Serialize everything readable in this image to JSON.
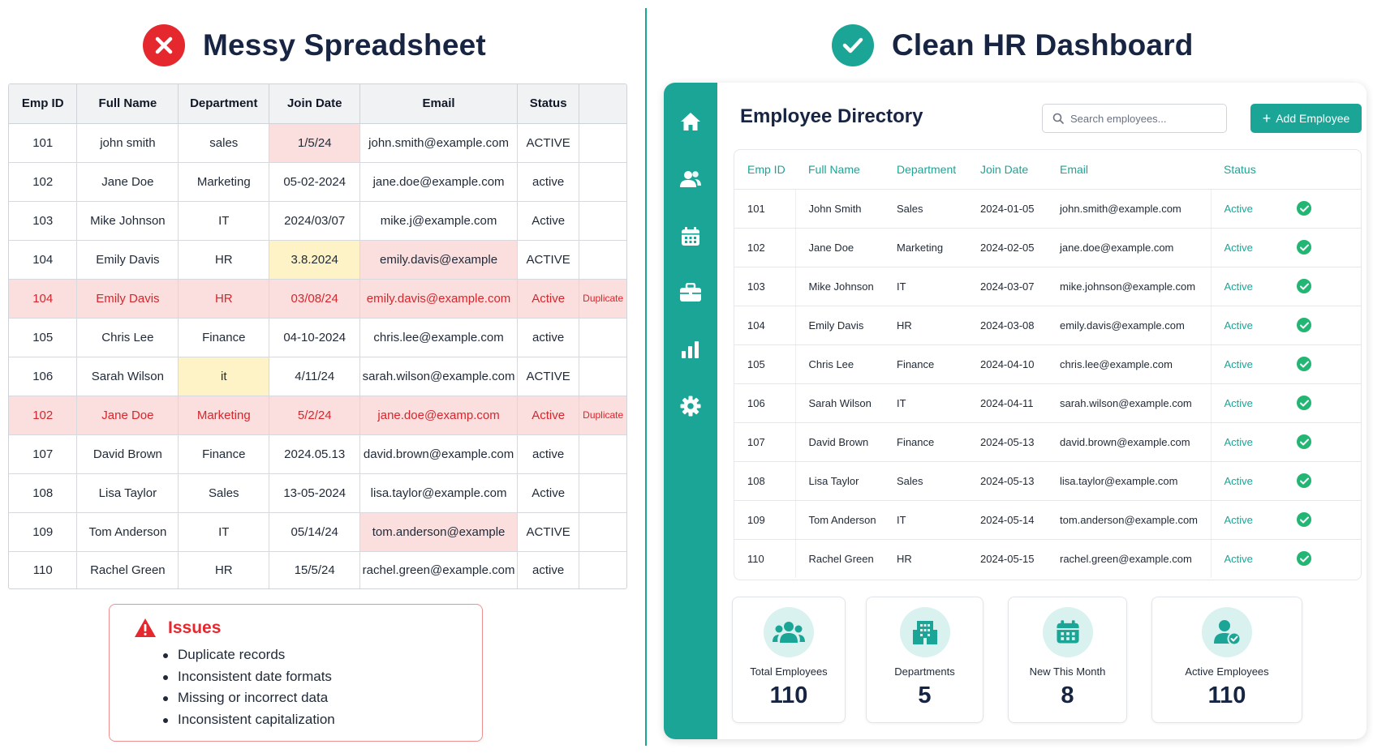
{
  "colors": {
    "teal": "#1aa597",
    "red": "#e5282e",
    "navy": "#172543",
    "highlight_red": "#fbdfdf",
    "highlight_yellow": "#fdf3c6"
  },
  "messy": {
    "title": "Messy Spreadsheet",
    "title_icon": "x-circle-icon",
    "columns": [
      "Emp ID",
      "Full Name",
      "Department",
      "Join Date",
      "Email",
      "Status",
      ""
    ],
    "rows": [
      {
        "id": "101",
        "name": "john smith",
        "dept": "sales",
        "date": "1/5/24",
        "email": "john.smith@example.com",
        "status": "ACTIVE",
        "tag": ""
      },
      {
        "id": "102",
        "name": "Jane Doe",
        "dept": "Marketing",
        "date": "05-02-2024",
        "email": "jane.doe@example.com",
        "status": "active",
        "tag": ""
      },
      {
        "id": "103",
        "name": "Mike Johnson",
        "dept": "IT",
        "date": "2024/03/07",
        "email": "mike.j@example.com",
        "status": "Active",
        "tag": ""
      },
      {
        "id": "104",
        "name": "Emily Davis",
        "dept": "HR",
        "date": "3.8.2024",
        "email": "emily.davis@example",
        "status": "ACTIVE",
        "tag": ""
      },
      {
        "id": "104",
        "name": "Emily Davis",
        "dept": "HR",
        "date": "03/08/24",
        "email": "emily.davis@example.com",
        "status": "Active",
        "tag": "Duplicate"
      },
      {
        "id": "105",
        "name": "Chris Lee",
        "dept": "Finance",
        "date": "04-10-2024",
        "email": "chris.lee@example.com",
        "status": "active",
        "tag": ""
      },
      {
        "id": "106",
        "name": "Sarah Wilson",
        "dept": "it",
        "date": "4/11/24",
        "email": "sarah.wilson@example.com",
        "status": "ACTIVE",
        "tag": ""
      },
      {
        "id": "102",
        "name": "Jane Doe",
        "dept": "Marketing",
        "date": "5/2/24",
        "email": "jane.doe@examp.com",
        "status": "Active",
        "tag": "Duplicate"
      },
      {
        "id": "107",
        "name": "David Brown",
        "dept": "Finance",
        "date": "2024.05.13",
        "email": "david.brown@example.com",
        "status": "active",
        "tag": ""
      },
      {
        "id": "108",
        "name": "Lisa Taylor",
        "dept": "Sales",
        "date": "13-05-2024",
        "email": "lisa.taylor@example.com",
        "status": "Active",
        "tag": ""
      },
      {
        "id": "109",
        "name": "Tom Anderson",
        "dept": "IT",
        "date": "05/14/24",
        "email": "tom.anderson@example",
        "status": "ACTIVE",
        "tag": ""
      },
      {
        "id": "110",
        "name": "Rachel Green",
        "dept": "HR",
        "date": "15/5/24",
        "email": "rachel.green@example.com",
        "status": "active",
        "tag": ""
      }
    ]
  },
  "issues": {
    "title": "Issues",
    "icon": "warning-triangle-icon",
    "items": [
      "Duplicate records",
      "Inconsistent date formats",
      "Missing or incorrect data",
      "Inconsistent capitalization"
    ]
  },
  "clean": {
    "title": "Clean HR Dashboard",
    "title_icon": "check-circle-icon",
    "nav": [
      {
        "name": "home-icon"
      },
      {
        "name": "users-icon"
      },
      {
        "name": "calendar-icon"
      },
      {
        "name": "briefcase-icon"
      },
      {
        "name": "bar-chart-icon"
      },
      {
        "name": "gear-icon"
      }
    ],
    "directory_title": "Employee Directory",
    "search": {
      "placeholder": "Search employees...",
      "value": "",
      "icon": "search-icon"
    },
    "add_button": "Add Employee",
    "columns": [
      "Emp ID",
      "Full Name",
      "Department",
      "Join Date",
      "Email",
      "Status"
    ],
    "rows": [
      {
        "id": "101",
        "name": "John Smith",
        "dept": "Sales",
        "date": "2024-01-05",
        "email": "john.smith@example.com",
        "status": "Active"
      },
      {
        "id": "102",
        "name": "Jane Doe",
        "dept": "Marketing",
        "date": "2024-02-05",
        "email": "jane.doe@example.com",
        "status": "Active"
      },
      {
        "id": "103",
        "name": "Mike Johnson",
        "dept": "IT",
        "date": "2024-03-07",
        "email": "mike.johnson@example.com",
        "status": "Active"
      },
      {
        "id": "104",
        "name": "Emily Davis",
        "dept": "HR",
        "date": "2024-03-08",
        "email": "emily.davis@example.com",
        "status": "Active"
      },
      {
        "id": "105",
        "name": "Chris Lee",
        "dept": "Finance",
        "date": "2024-04-10",
        "email": "chris.lee@example.com",
        "status": "Active"
      },
      {
        "id": "106",
        "name": "Sarah Wilson",
        "dept": "IT",
        "date": "2024-04-11",
        "email": "sarah.wilson@example.com",
        "status": "Active"
      },
      {
        "id": "107",
        "name": "David Brown",
        "dept": "Finance",
        "date": "2024-05-13",
        "email": "david.brown@example.com",
        "status": "Active"
      },
      {
        "id": "108",
        "name": "Lisa Taylor",
        "dept": "Sales",
        "date": "2024-05-13",
        "email": "lisa.taylor@example.com",
        "status": "Active"
      },
      {
        "id": "109",
        "name": "Tom Anderson",
        "dept": "IT",
        "date": "2024-05-14",
        "email": "tom.anderson@example.com",
        "status": "Active"
      },
      {
        "id": "110",
        "name": "Rachel Green",
        "dept": "HR",
        "date": "2024-05-15",
        "email": "rachel.green@example.com",
        "status": "Active"
      }
    ],
    "stats": [
      {
        "label": "Total Employees",
        "value": "110",
        "icon": "users-group-icon"
      },
      {
        "label": "Departments",
        "value": "5",
        "icon": "building-icon"
      },
      {
        "label": "New This Month",
        "value": "8",
        "icon": "calendar-icon"
      },
      {
        "label": "Active Employees",
        "value": "110",
        "icon": "user-check-icon"
      }
    ]
  }
}
